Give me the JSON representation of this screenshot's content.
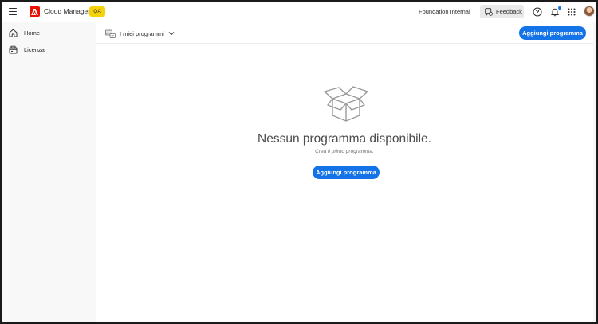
{
  "topbar": {
    "app_title": "Cloud Manager",
    "env_badge": "QA",
    "org_name": "Foundation Internal",
    "feedback_label": "Feedback",
    "notification_indicator_color": "#1473e6",
    "icons": [
      "menu-icon",
      "adobe-logo-icon",
      "feedback-icon",
      "help-icon",
      "bell-icon",
      "apps-grid-icon"
    ]
  },
  "sidebar": {
    "items": [
      {
        "label": "Home",
        "icon": "home-icon"
      },
      {
        "label": "Licenza",
        "icon": "license-icon"
      }
    ]
  },
  "main": {
    "program_picker_label": "I miei programmi",
    "add_program_label": "Aggiungi programma",
    "empty_state": {
      "title": "Nessun programma disponibile.",
      "subtitle": "Crea il primo programma.",
      "button_label": "Aggiungi programma",
      "icon": "empty-box-icon"
    }
  },
  "colors": {
    "accent": "#1473e6",
    "brand": "#eb1000",
    "badge": "#f5d20a",
    "page_bg": "#f8f8f8"
  }
}
